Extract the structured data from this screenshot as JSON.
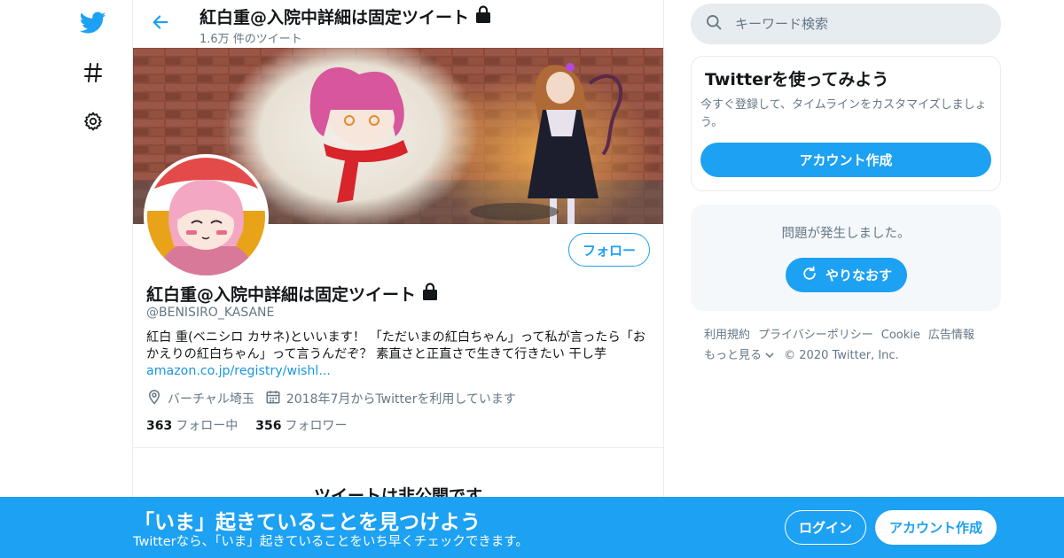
{
  "nav": {
    "icons": [
      "twitter-bird-icon",
      "hashtag-icon",
      "gear-icon"
    ]
  },
  "header": {
    "title": "紅白重@入院中詳細は固定ツイート",
    "tweet_count": "1.6万 件のツイート",
    "lock_icon": "lock-icon"
  },
  "profile": {
    "follow_label": "フォロー",
    "name": "紅白重@入院中詳細は固定ツイート",
    "handle": "@BENISIRO_KASANE",
    "bio_text": "紅白 重(ベニシロ カサネ)といいます！ 「ただいまの紅白ちゃん」って私が言ったら「おかえりの紅白ちゃん」って言うんだぞ？ 素直さと正直さで生きて行きたい 干し芋 ",
    "bio_link": "amazon.co.jp/registry/wishl...",
    "location": "バーチャル埼玉",
    "joined": "2018年7月からTwitterを利用しています",
    "following_count": "363",
    "following_label": "フォロー中",
    "followers_count": "356",
    "followers_label": "フォロワー",
    "protected_heading": "ツイートは非公開です"
  },
  "sidebar": {
    "search_placeholder": "キーワード検索",
    "signup_card": {
      "title": "Twitterを使ってみよう",
      "description": "今すぐ登録して、タイムラインをカスタマイズしましょう。",
      "button": "アカウント作成"
    },
    "error_card": {
      "message": "問題が発生しました。",
      "retry": "やりなおす"
    },
    "footer": {
      "terms": "利用規約",
      "privacy": "プライバシーポリシー",
      "cookie": "Cookie",
      "ads": "広告情報",
      "more": "もっと見る",
      "copyright": "© 2020 Twitter, Inc."
    }
  },
  "bottom_bar": {
    "title": "「いま」起きていることを見つけよう",
    "subtitle": "Twitterなら、「いま」起きていることをいち早くチェックできます。",
    "login": "ログイン",
    "signup": "アカウント作成"
  },
  "colors": {
    "accent": "#1da1f2",
    "text_secondary": "#657786",
    "link": "#1b95e0"
  }
}
